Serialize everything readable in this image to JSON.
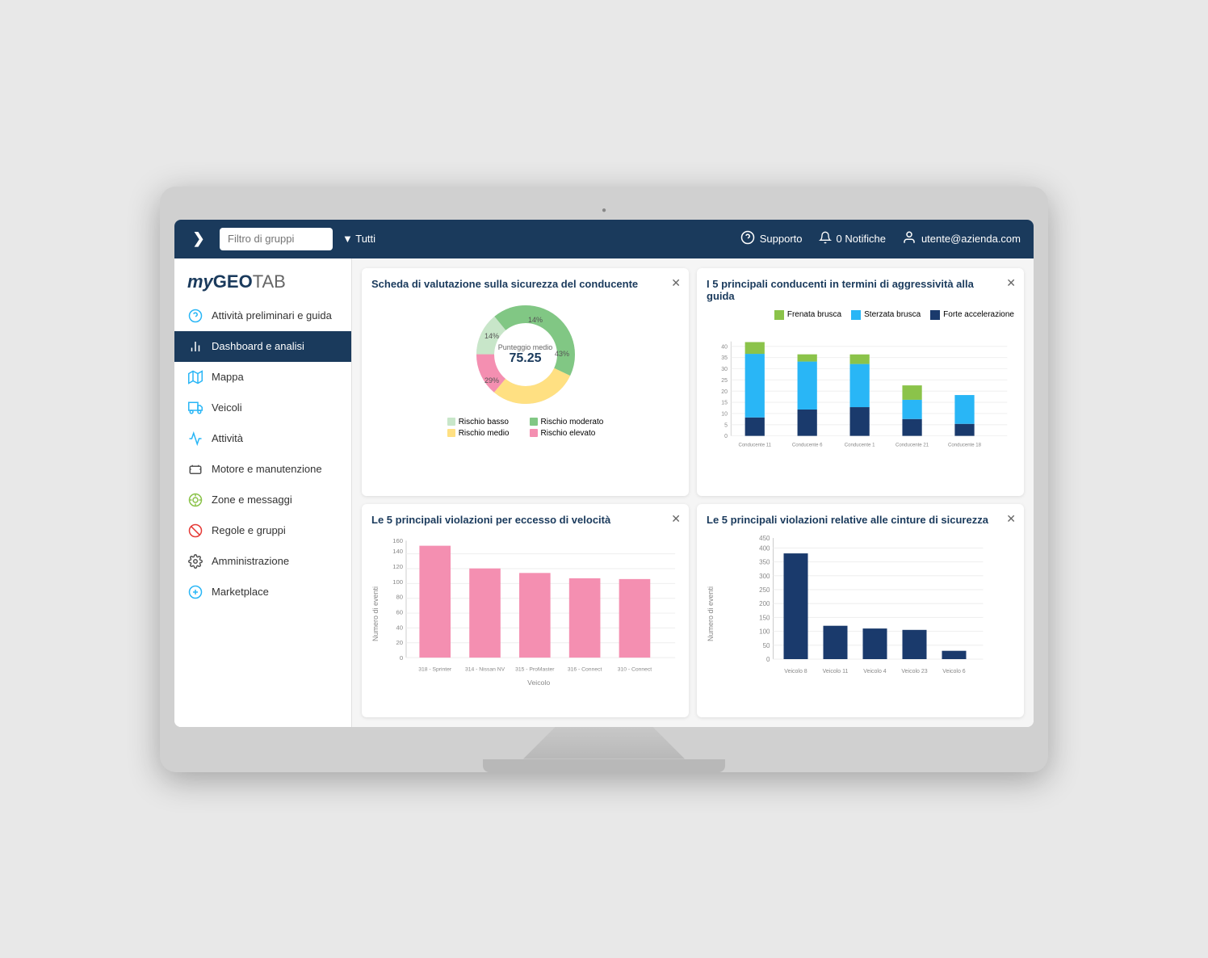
{
  "monitor": {
    "dot": "●"
  },
  "topbar": {
    "arrow": "❯",
    "filter_placeholder": "Filtro di gruppi",
    "filter_dropdown_label": "▼ Tutti",
    "support_label": "Supporto",
    "notifications_label": "0 Notifiche",
    "user_label": "utente@azienda.com"
  },
  "sidebar": {
    "logo_my": "my",
    "logo_geo": "GEO",
    "logo_tab": "TAB",
    "items": [
      {
        "id": "attivita",
        "label": "Attività preliminari e guida",
        "icon": "?"
      },
      {
        "id": "dashboard",
        "label": "Dashboard e analisi",
        "icon": "chart",
        "active": true
      },
      {
        "id": "mappa",
        "label": "Mappa",
        "icon": "map"
      },
      {
        "id": "veicoli",
        "label": "Veicoli",
        "icon": "truck"
      },
      {
        "id": "attivita2",
        "label": "Attività",
        "icon": "activity"
      },
      {
        "id": "motore",
        "label": "Motore e manutenzione",
        "icon": "engine"
      },
      {
        "id": "zone",
        "label": "Zone e messaggi",
        "icon": "zone"
      },
      {
        "id": "regole",
        "label": "Regole e gruppi",
        "icon": "rules"
      },
      {
        "id": "admin",
        "label": "Amministrazione",
        "icon": "admin"
      },
      {
        "id": "marketplace",
        "label": "Marketplace",
        "icon": "marketplace"
      }
    ]
  },
  "card1": {
    "title": "Scheda di valutazione sulla sicurezza del conducente",
    "center_label": "Punteggio medio",
    "center_value": "75.25",
    "segments": [
      {
        "label": "14%",
        "value": 14,
        "color": "#c8e6c9",
        "angle_start": 0
      },
      {
        "label": "43%",
        "value": 43,
        "color": "#a5d6a7",
        "angle_start": 50
      },
      {
        "label": "29%",
        "value": 29,
        "color": "#ffe082",
        "angle_start": 205
      },
      {
        "label": "14%",
        "value": 14,
        "color": "#f48fb1",
        "angle_start": 309
      }
    ],
    "legend": [
      {
        "label": "Rischio basso",
        "color": "#c8e6c9"
      },
      {
        "label": "Rischio moderato",
        "color": "#a5d6a7"
      },
      {
        "label": "Rischio medio",
        "color": "#ffe082"
      },
      {
        "label": "Rischio elevato",
        "color": "#f48fb1"
      }
    ]
  },
  "card2": {
    "title": "I 5 principali conducenti in termini di aggressività alla guida",
    "legend": [
      {
        "label": "Frenata brusca",
        "color": "#8bc34a"
      },
      {
        "label": "Sterzata brusca",
        "color": "#29b6f6"
      },
      {
        "label": "Forte accelerazione",
        "color": "#1a3a6c"
      }
    ],
    "y_max": 45,
    "y_ticks": [
      0,
      5,
      10,
      15,
      20,
      25,
      30,
      35,
      40,
      45
    ],
    "bars": [
      {
        "label": "Conducente 11",
        "green": 5,
        "blue": 27,
        "dark": 8
      },
      {
        "label": "Conducente 6",
        "green": 3,
        "blue": 20,
        "dark": 11
      },
      {
        "label": "Conducente 1",
        "green": 4,
        "blue": 18,
        "dark": 12
      },
      {
        "label": "Conducente 21",
        "green": 6,
        "blue": 8,
        "dark": 7
      },
      {
        "label": "Conducente 18",
        "green": 0,
        "blue": 12,
        "dark": 5
      }
    ]
  },
  "card3": {
    "title": "Le 5 principali violazioni per eccesso di velocità",
    "y_label": "Numero di eventi",
    "x_label": "Veicolo",
    "y_max": 160,
    "y_ticks": [
      0,
      20,
      40,
      60,
      80,
      100,
      120,
      140,
      160
    ],
    "bars": [
      {
        "label": "318 - Sprinter",
        "value": 148
      },
      {
        "label": "314 - Nissan NV",
        "value": 118
      },
      {
        "label": "315 - ProMaster",
        "value": 112
      },
      {
        "label": "316 - Connect",
        "value": 105
      },
      {
        "label": "310 - Connect",
        "value": 104
      }
    ],
    "color": "#f48fb1"
  },
  "card4": {
    "title": "Le 5 principali violazioni relative alle cinture di sicurezza",
    "y_label": "Numero di eventi",
    "y_max": 450,
    "y_ticks": [
      0,
      50,
      100,
      150,
      200,
      250,
      300,
      350,
      400,
      450
    ],
    "bars": [
      {
        "label": "Veicolo 8",
        "value": 380
      },
      {
        "label": "Veicolo 11",
        "value": 120
      },
      {
        "label": "Veicolo 4",
        "value": 110
      },
      {
        "label": "Veicolo 23",
        "value": 105
      },
      {
        "label": "Veicolo 6",
        "value": 30
      }
    ],
    "color": "#1a3a6c"
  }
}
